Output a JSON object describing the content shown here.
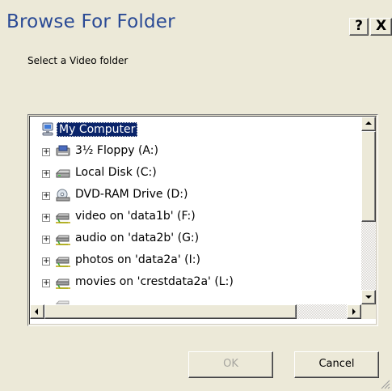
{
  "window": {
    "title": "Browse For Folder",
    "help_label": "?",
    "close_label": "X"
  },
  "prompt": "Select a Video folder",
  "tree": {
    "root": {
      "label": "My Computer",
      "icon": "my-computer-icon"
    },
    "items": [
      {
        "label": "3½ Floppy (A:)",
        "icon": "floppy-drive-icon",
        "expander": "+"
      },
      {
        "label": "Local Disk (C:)",
        "icon": "hard-disk-icon",
        "expander": "+"
      },
      {
        "label": "DVD-RAM Drive (D:)",
        "icon": "dvd-drive-icon",
        "expander": "+"
      },
      {
        "label": "video on 'data1b' (F:)",
        "icon": "network-drive-icon",
        "expander": "+"
      },
      {
        "label": "audio on 'data2b' (G:)",
        "icon": "network-drive-icon",
        "expander": "+"
      },
      {
        "label": "photos on 'data2a' (I:)",
        "icon": "network-drive-icon",
        "expander": "+"
      },
      {
        "label": "movies on 'crestdata2a' (L:)",
        "icon": "network-drive-icon",
        "expander": "+"
      }
    ]
  },
  "buttons": {
    "ok": "OK",
    "cancel": "Cancel"
  },
  "colors": {
    "title_text": "#2a4a95",
    "selection_bg": "#0a246a",
    "dialog_bg": "#ece9d8"
  }
}
